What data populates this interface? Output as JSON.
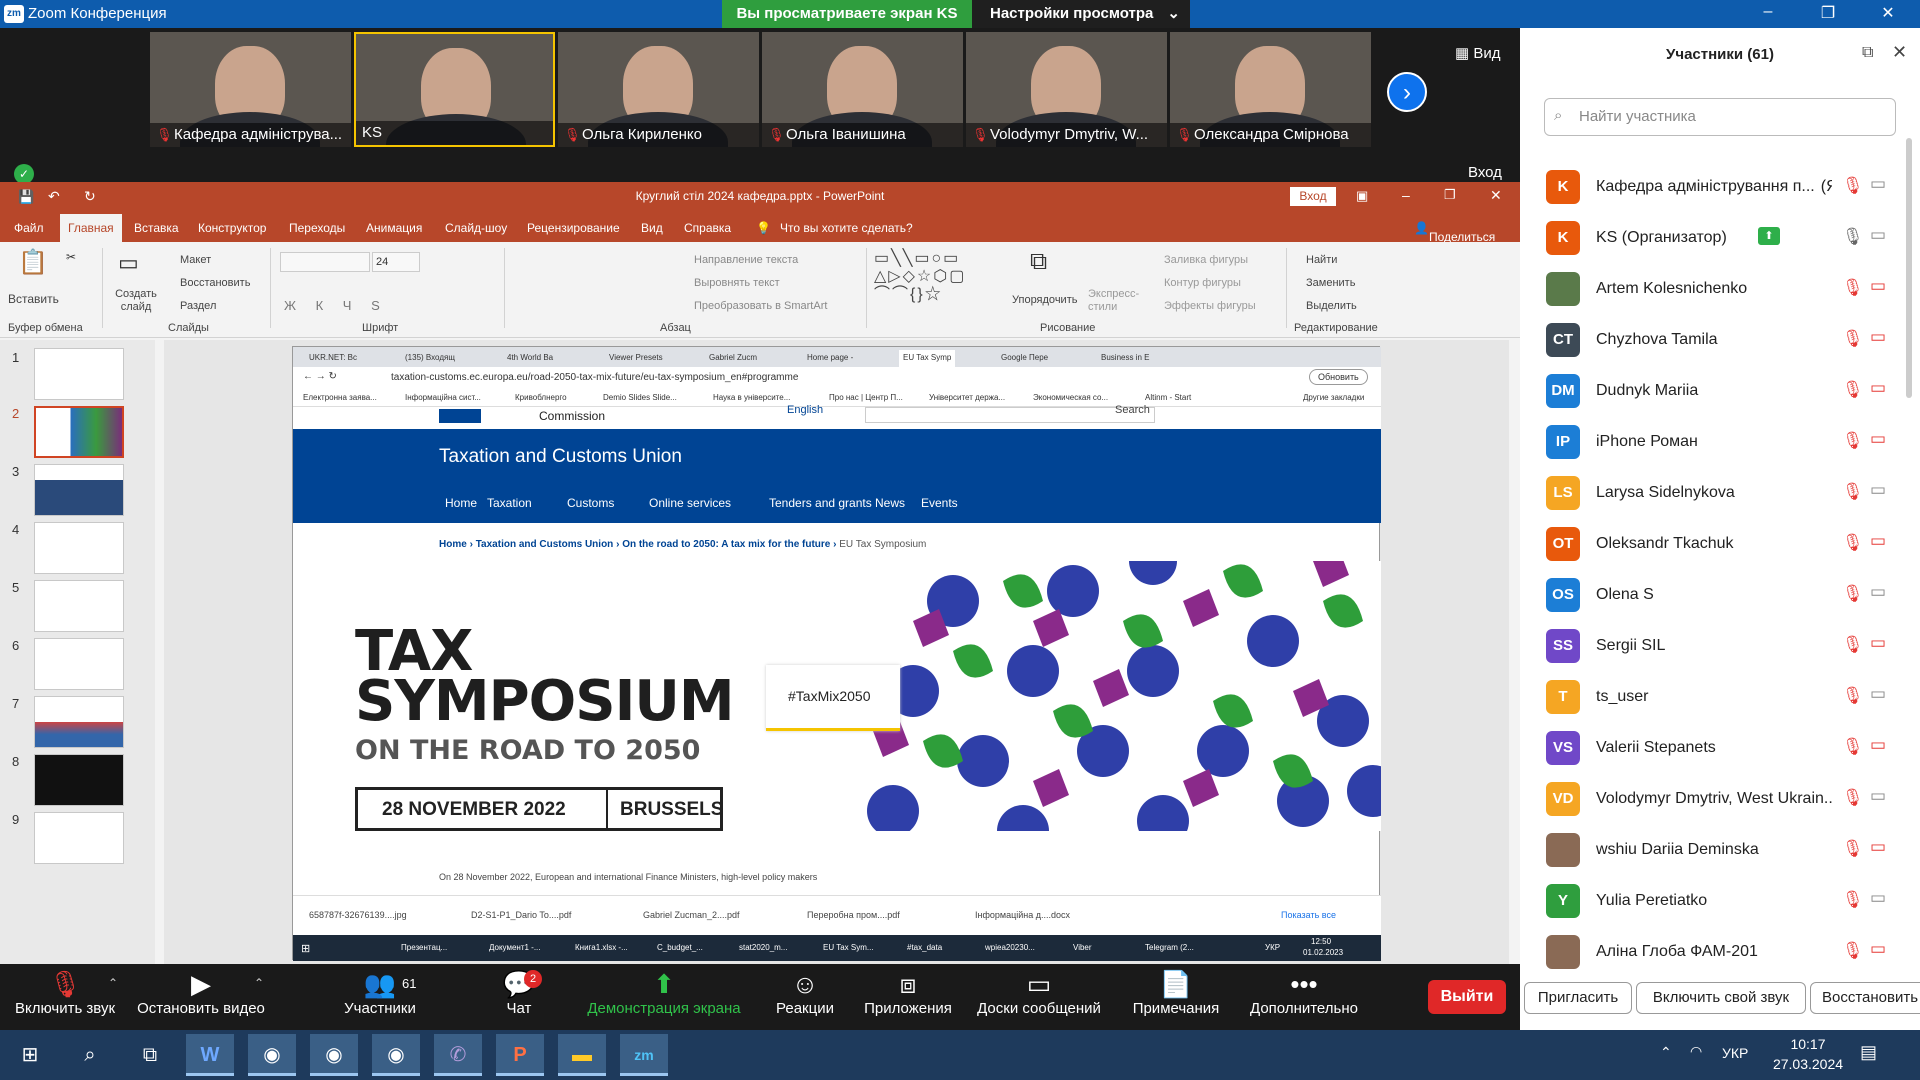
{
  "zoom": {
    "window_title": "Zoom Конференция",
    "share_banner": "Вы просматриваете экран KS",
    "view_settings": "Настройки просмотра",
    "view_label": "Вид",
    "enter_label": "Вход"
  },
  "videos": [
    "Кафедра адмініструва...",
    "KS",
    "Ольга Кириленко",
    "Ольга Іванишина",
    "Volodymyr Dmytriv, W...",
    "Олександра Смірнова"
  ],
  "ppt": {
    "title": "Круглий стіл 2024 кафедра.pptx - PowerPoint",
    "vhod": "Вход",
    "menu": [
      "Файл",
      "Главная",
      "Вставка",
      "Конструктор",
      "Переходы",
      "Анимация",
      "Слайд-шоу",
      "Рецензирование",
      "Вид",
      "Справка"
    ],
    "tell_me": "Что вы хотите сделать?",
    "share": "Поделиться",
    "ribbon": {
      "paste": "Вставить",
      "create_slide": "Создать слайд",
      "layout": "Макет",
      "reset": "Восстановить",
      "section": "Раздел",
      "clipboard": "Буфер обмена",
      "slides": "Слайды",
      "font": "Шрифт",
      "paragraph": "Абзац",
      "drawing": "Рисование",
      "editing": "Редактирование",
      "text_dir": "Направление текста",
      "align_text": "Выровнять текст",
      "smartart": "Преобразовать в SmartArt",
      "arrange": "Упорядочить",
      "express": "Экспресс-стили",
      "fill": "Заливка фигуры",
      "outline": "Контур фигуры",
      "effects": "Эффекты фигуры",
      "find": "Найти",
      "replace": "Заменить",
      "select": "Выделить",
      "font_size": "24"
    },
    "slide_numbers": [
      "1",
      "2",
      "3",
      "4",
      "5",
      "6",
      "7",
      "8",
      "9"
    ]
  },
  "browser": {
    "tabs": [
      "UKR.NET: Вс",
      "(135) Входящ",
      "4th World Ba",
      "Viewer Presets",
      "Gabriel Zucm",
      "Home page -",
      "EU Tax Symp",
      "Google Пере",
      "Business in E"
    ],
    "url": "taxation-customs.ec.europa.eu/road-2050-tax-mix-future/eu-tax-symposium_en#programme",
    "update": "Обновить",
    "bookmarks": [
      "Електронна заява...",
      "Інформаційна сист...",
      "Кривоблнерго",
      "Demio Slides Slide...",
      "Наука в університе...",
      "Про нас | Центр П...",
      "Університет держа...",
      "Экономическая со...",
      "Altinm - Start",
      "Другие закладки"
    ],
    "commission": "Commission",
    "english": "English",
    "search": "Search",
    "site_title": "Taxation and Customs Union",
    "nav": [
      "Home",
      "Taxation",
      "Customs",
      "Online services",
      "Tenders and grants",
      "News",
      "Events"
    ],
    "breadcrumb": [
      "Home",
      "Taxation and Customs Union",
      "On the road to 2050: A tax mix for the future",
      "EU Tax Symposium"
    ],
    "hero": {
      "line1": "TAX",
      "line2": "SYMPOSIUM",
      "line3": "ON THE ROAD TO 2050",
      "date": "28 NOVEMBER 2022",
      "place": "BRUSSELS",
      "hashtag": "#TaxMix2050"
    },
    "body_text": "On 28 November 2022, European and international Finance Ministers, high-level policy makers",
    "downloads": [
      "658787f-32676139....jpg",
      "D2-S1-P1_Dario To....pdf",
      "Gabriel Zucman_2....pdf",
      "Переробна пром....pdf",
      "Інформаційна д....docx"
    ],
    "show_all": "Показать все",
    "taskbar": [
      "Презентац...",
      "Документ1 -...",
      "Книга1.xlsx -...",
      "C_budget_...",
      "stat2020_m...",
      "EU Tax Sym...",
      "#tax_data",
      "wpiea20230...",
      "Viber",
      "Telegram (2..."
    ],
    "tray_lang": "УКР",
    "tray_time": "12:50",
    "tray_date": "01.02.2023"
  },
  "participants": {
    "title": "Участники (61)",
    "search_placeholder": "Найти участника",
    "list": [
      {
        "initials": "K",
        "name": "Кафедра адміністрування п...",
        "tag": "(Я)",
        "color": "#e8590c"
      },
      {
        "initials": "K",
        "name": "KS (Организатор)",
        "tag": "",
        "color": "#e8590c"
      },
      {
        "initials": "",
        "name": "Artem Kolesnichenko",
        "tag": "",
        "color": "#5a7a4a"
      },
      {
        "initials": "CT",
        "name": "Chyzhova Tamila",
        "tag": "",
        "color": "#3d4a56"
      },
      {
        "initials": "DM",
        "name": "Dudnyk Mariia",
        "tag": "",
        "color": "#1c7ed6"
      },
      {
        "initials": "IP",
        "name": "iPhone Роман",
        "tag": "",
        "color": "#1c7ed6"
      },
      {
        "initials": "LS",
        "name": "Larysa Sidelnykova",
        "tag": "",
        "color": "#f5a623"
      },
      {
        "initials": "OT",
        "name": "Oleksandr Tkachuk",
        "tag": "",
        "color": "#e8590c"
      },
      {
        "initials": "OS",
        "name": "Olena S",
        "tag": "",
        "color": "#1c7ed6"
      },
      {
        "initials": "SS",
        "name": "Sergii SIL",
        "tag": "",
        "color": "#7048c8"
      },
      {
        "initials": "T",
        "name": "ts_user",
        "tag": "",
        "color": "#f5a623"
      },
      {
        "initials": "VS",
        "name": "Valerii Stepanets",
        "tag": "",
        "color": "#7048c8"
      },
      {
        "initials": "VD",
        "name": "Volodymyr Dmytriv, West Ukrain...",
        "tag": "",
        "color": "#f5a623"
      },
      {
        "initials": "",
        "name": "wshiu Dariia Deminska",
        "tag": "",
        "color": "#8a6a55"
      },
      {
        "initials": "Y",
        "name": "Yulia Peretiatko",
        "tag": "",
        "color": "#2f9e3e"
      },
      {
        "initials": "",
        "name": "Аліна Глоба ФАМ-201",
        "tag": "",
        "color": "#8a6a55"
      }
    ],
    "invite": "Пригласить",
    "unmute": "Включить свой звук",
    "restore": "Восстановить"
  },
  "toolbar": {
    "unmute": "Включить звук",
    "video": "Остановить видео",
    "participants": "Участники",
    "participants_count": "61",
    "chat": "Чат",
    "chat_badge": "2",
    "share": "Демонстрация экрана",
    "reactions": "Реакции",
    "apps": "Приложения",
    "whiteboards": "Доски сообщений",
    "notes": "Примечания",
    "more": "Дополнительно",
    "leave": "Выйти"
  },
  "taskbar": {
    "lang": "УКР",
    "time": "10:17",
    "date": "27.03.2024"
  }
}
